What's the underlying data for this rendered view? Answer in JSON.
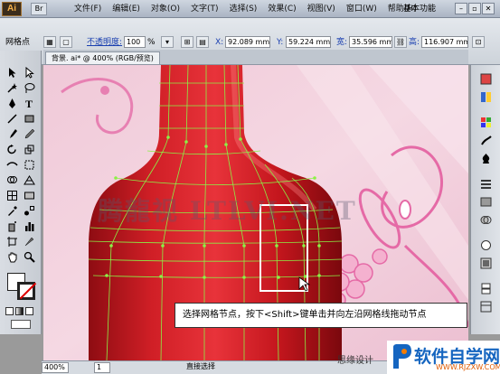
{
  "app": {
    "logo": "Ai",
    "bridge_button": "Br",
    "workspace": "基本功能"
  },
  "menu": [
    "文件(F)",
    "编辑(E)",
    "对象(O)",
    "文字(T)",
    "选择(S)",
    "效果(C)",
    "视图(V)",
    "窗口(W)",
    "帮助(H)"
  ],
  "window_buttons": [
    "–",
    "▫",
    "✕"
  ],
  "control_bar": {
    "selection_label": "网格点",
    "opacity_label": "不透明度:",
    "opacity_value": "100",
    "opacity_unit": "%",
    "x_label": "X:",
    "x_value": "92.089 mm",
    "y_label": "Y:",
    "y_value": "59.224 mm",
    "w_label": "宽:",
    "w_value": "35.596 mm",
    "h_label": "高:",
    "h_value": "116.907 mm"
  },
  "document": {
    "tab_label": "背景. ai* @ 400% (RGB/预览)"
  },
  "status": {
    "zoom": "400%",
    "page": "1",
    "tool_name": "直接选择"
  },
  "caption": "选择网格节点，按下<Shift>键单击并向左沿网格线拖动节点",
  "watermarks": {
    "mid": "腾龍视 LTLVI.NET",
    "bottom": "思缘设计",
    "brand_name": "软件自学网",
    "brand_url": "WWW.RJZXW.COM"
  },
  "colors": {
    "bottle": "#c8141c",
    "mesh": "#7dff3c",
    "background": "#f2cbd9",
    "accent_pink": "#e85aa0"
  }
}
